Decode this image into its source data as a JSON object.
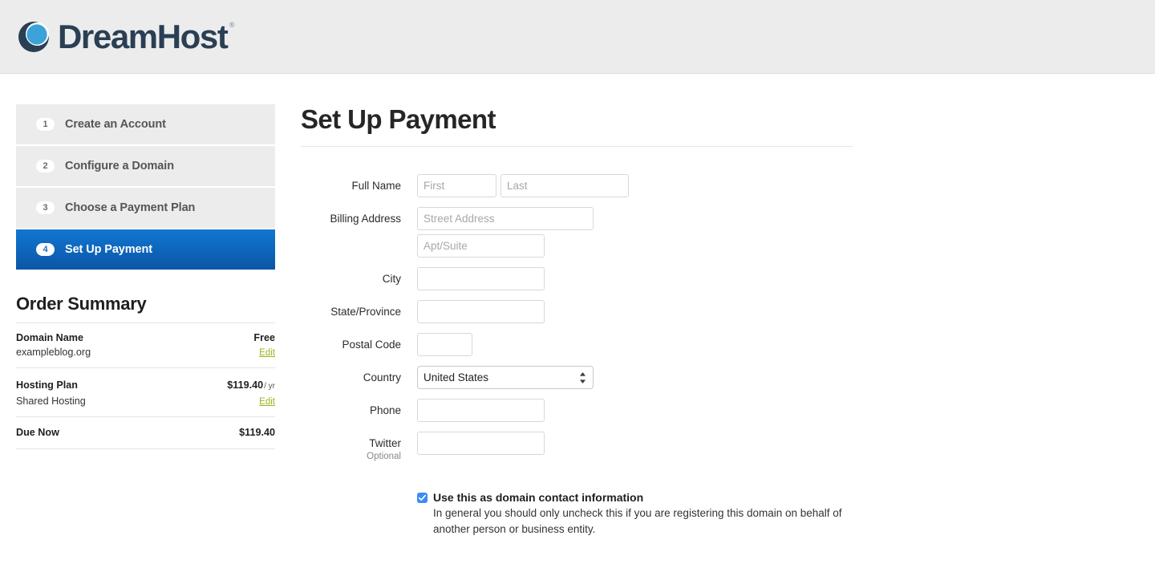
{
  "header": {
    "brand_name": "DreamHost",
    "registered_mark": "®",
    "logo_icon": "dreamhost-crescent-logo",
    "bg_color": "#ececec",
    "brand_color": "#2a3f54",
    "accent_blue": "#38a0d8"
  },
  "sidebar": {
    "steps": [
      {
        "number": "1",
        "label": "Create an Account",
        "active": false
      },
      {
        "number": "2",
        "label": "Configure a Domain",
        "active": false
      },
      {
        "number": "3",
        "label": "Choose a Payment Plan",
        "active": false
      },
      {
        "number": "4",
        "label": "Set Up Payment",
        "active": true
      }
    ],
    "order_summary": {
      "title": "Order Summary",
      "rows": [
        {
          "label": "Domain Name",
          "sub_label": "exampleblog.org",
          "value": "Free",
          "value_suffix": "",
          "action": "Edit"
        },
        {
          "label": "Hosting Plan",
          "sub_label": "Shared Hosting",
          "value": "$119.40",
          "value_suffix": "/ yr",
          "action": "Edit"
        }
      ],
      "total": {
        "label": "Due Now",
        "value": "$119.40"
      },
      "link_color": "#9cb11a"
    }
  },
  "main": {
    "title": "Set Up Payment",
    "fields": {
      "full_name": {
        "label": "Full Name",
        "first_placeholder": "First",
        "first_value": "",
        "last_placeholder": "Last",
        "last_value": ""
      },
      "billing_address": {
        "label": "Billing Address",
        "street_placeholder": "Street Address",
        "street_value": "",
        "apt_placeholder": "Apt/Suite",
        "apt_value": ""
      },
      "city": {
        "label": "City",
        "value": "",
        "placeholder": ""
      },
      "state": {
        "label": "State/Province",
        "value": "",
        "placeholder": ""
      },
      "postal": {
        "label": "Postal Code",
        "value": "",
        "placeholder": ""
      },
      "country": {
        "label": "Country",
        "selected": "United States",
        "options": [
          "United States"
        ]
      },
      "phone": {
        "label": "Phone",
        "value": "",
        "placeholder": ""
      },
      "twitter": {
        "label": "Twitter",
        "sub_label": "Optional",
        "value": "",
        "placeholder": ""
      }
    },
    "domain_contact": {
      "checked": true,
      "title": "Use this as domain contact information",
      "description": "In general you should only uncheck this if you are registering this domain on behalf of another person or business entity.",
      "checkbox_color": "#3b8cf5"
    }
  }
}
